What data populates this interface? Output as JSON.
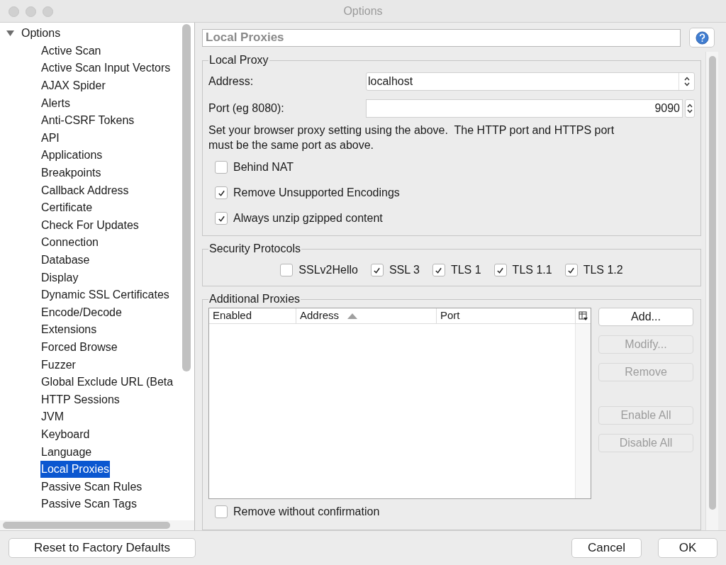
{
  "window": {
    "title": "Options"
  },
  "tree": {
    "label": "Options",
    "expanded": true,
    "children": [
      {
        "label": "Active Scan",
        "selected": false
      },
      {
        "label": "Active Scan Input Vectors",
        "selected": false
      },
      {
        "label": "AJAX Spider",
        "selected": false
      },
      {
        "label": "Alerts",
        "selected": false
      },
      {
        "label": "Anti-CSRF Tokens",
        "selected": false
      },
      {
        "label": "API",
        "selected": false
      },
      {
        "label": "Applications",
        "selected": false
      },
      {
        "label": "Breakpoints",
        "selected": false
      },
      {
        "label": "Callback Address",
        "selected": false
      },
      {
        "label": "Certificate",
        "selected": false
      },
      {
        "label": "Check For Updates",
        "selected": false
      },
      {
        "label": "Connection",
        "selected": false
      },
      {
        "label": "Database",
        "selected": false
      },
      {
        "label": "Display",
        "selected": false
      },
      {
        "label": "Dynamic SSL Certificates",
        "selected": false
      },
      {
        "label": "Encode/Decode",
        "selected": false
      },
      {
        "label": "Extensions",
        "selected": false
      },
      {
        "label": "Forced Browse",
        "selected": false
      },
      {
        "label": "Fuzzer",
        "selected": false
      },
      {
        "label": "Global Exclude URL (Beta",
        "selected": false
      },
      {
        "label": "HTTP Sessions",
        "selected": false
      },
      {
        "label": "JVM",
        "selected": false
      },
      {
        "label": "Keyboard",
        "selected": false
      },
      {
        "label": "Language",
        "selected": false
      },
      {
        "label": "Local Proxies",
        "selected": true
      },
      {
        "label": "Passive Scan Rules",
        "selected": false
      },
      {
        "label": "Passive Scan Tags",
        "selected": false
      }
    ]
  },
  "panel_title": "Local Proxies",
  "local_proxy": {
    "title": "Local Proxy",
    "address": {
      "label": "Address:",
      "value": "localhost"
    },
    "port": {
      "label": "Port (eg 8080):",
      "value": "9090"
    },
    "note": "Set your browser proxy setting using the above.  The HTTP port and HTTPS port must be the same port as above.",
    "options": [
      {
        "label": "Behind NAT",
        "checked": false
      },
      {
        "label": "Remove Unsupported Encodings",
        "checked": true
      },
      {
        "label": "Always unzip gzipped content",
        "checked": true
      }
    ]
  },
  "security_protocols": {
    "title": "Security Protocols",
    "protocols": [
      {
        "label": "SSLv2Hello",
        "checked": false
      },
      {
        "label": "SSL 3",
        "checked": true
      },
      {
        "label": "TLS 1",
        "checked": true
      },
      {
        "label": "TLS 1.1",
        "checked": true
      },
      {
        "label": "TLS 1.2",
        "checked": true
      }
    ]
  },
  "additional_proxies": {
    "title": "Additional Proxies",
    "table": {
      "columns": [
        {
          "label": "Enabled",
          "sorted": false
        },
        {
          "label": "Address",
          "sorted": true
        },
        {
          "label": "Port",
          "sorted": false
        }
      ]
    },
    "buttons": [
      {
        "label": "Add...",
        "disabled": false
      },
      {
        "label": "Modify...",
        "disabled": true
      },
      {
        "label": "Remove",
        "disabled": true
      },
      {
        "label": "Enable All",
        "disabled": true
      },
      {
        "label": "Disable All",
        "disabled": true
      }
    ],
    "remove_without_confirmation": {
      "label": "Remove without confirmation",
      "checked": false
    }
  },
  "footer": {
    "reset": "Reset to Factory Defaults",
    "cancel": "Cancel",
    "ok": "OK"
  }
}
